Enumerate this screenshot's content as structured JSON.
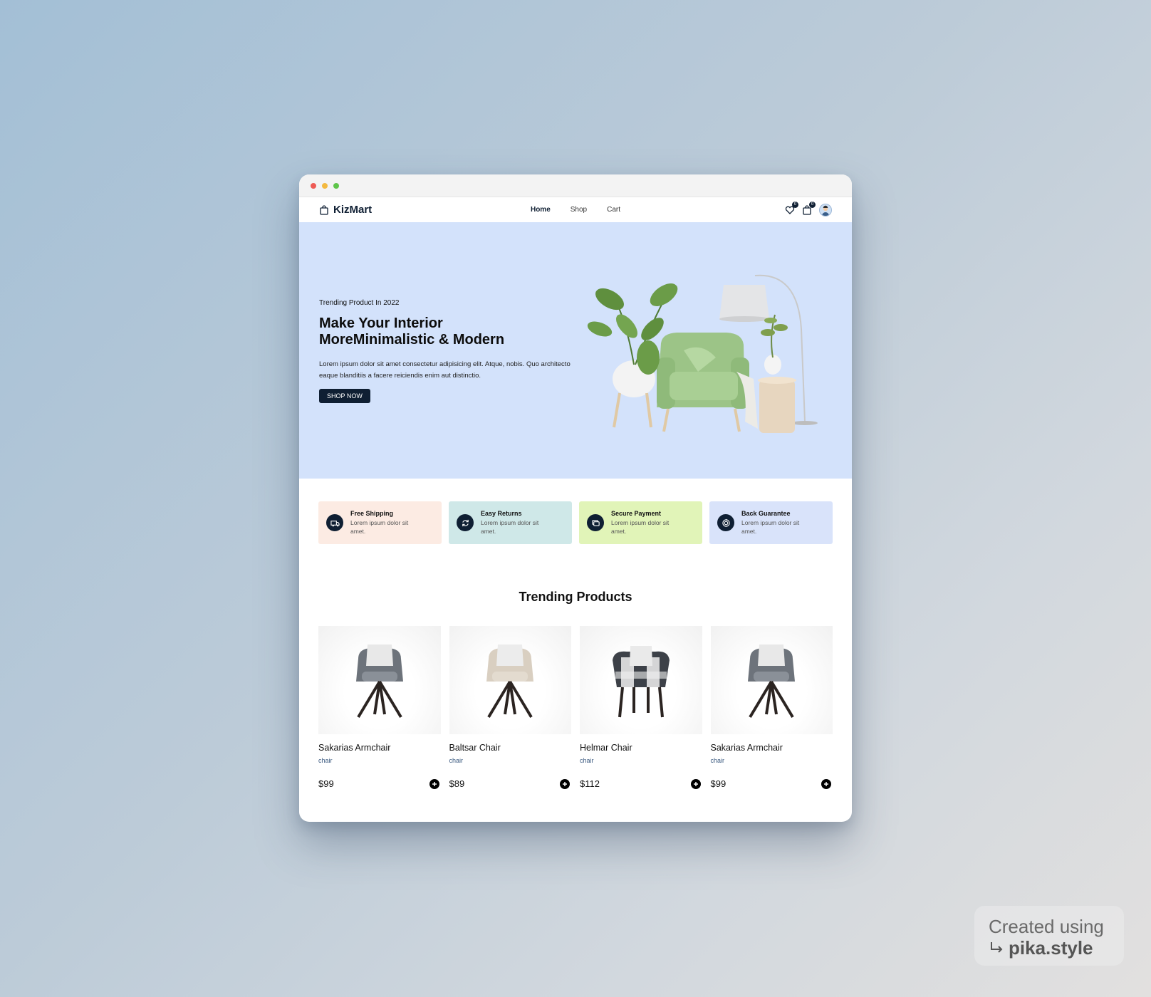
{
  "nav": {
    "brand": "KizMart",
    "links": [
      "Home",
      "Shop",
      "Cart"
    ],
    "wishlist_count": "0",
    "cart_count": "0"
  },
  "hero": {
    "kicker": "Trending Product In 2022",
    "title_line1": "Make Your Interior",
    "title_line2": "MoreMinimalistic & Modern",
    "description": "Lorem ipsum dolor sit amet consectetur adipisicing elit. Atque, nobis. Quo architecto eaque blanditiis a facere reiciendis enim aut distinctio.",
    "button": "SHOP NOW"
  },
  "features": [
    {
      "title": "Free Shipping",
      "text": "Lorem ipsum dolor sit amet.",
      "color": "#fcebe3",
      "icon": "truck-icon"
    },
    {
      "title": "Easy Returns",
      "text": "Lorem ipsum dolor sit amet.",
      "color": "#cfe8e8",
      "icon": "refresh-icon"
    },
    {
      "title": "Secure Payment",
      "text": "Lorem ipsum dolor sit amet.",
      "color": "#e1f4b8",
      "icon": "card-icon"
    },
    {
      "title": "Back Guarantee",
      "text": "Lorem ipsum dolor sit amet.",
      "color": "#d9e3fa",
      "icon": "shield-icon"
    }
  ],
  "trending": {
    "title": "Trending Products",
    "products": [
      {
        "name": "Sakarias Armchair",
        "category": "chair",
        "price": "$99"
      },
      {
        "name": "Baltsar Chair",
        "category": "chair",
        "price": "$89"
      },
      {
        "name": "Helmar Chair",
        "category": "chair",
        "price": "$112"
      },
      {
        "name": "Sakarias Armchair",
        "category": "chair",
        "price": "$99"
      }
    ]
  },
  "watermark": {
    "line1": "Created using",
    "line2": "pika.style"
  }
}
